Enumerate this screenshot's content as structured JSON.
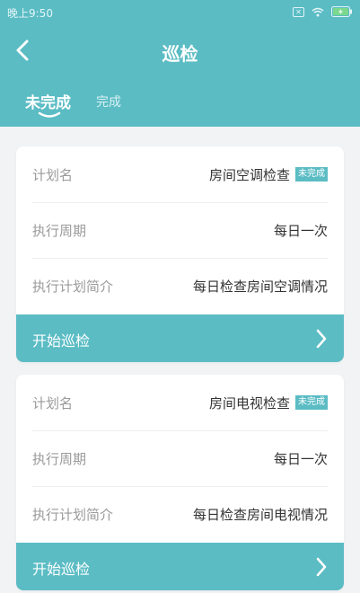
{
  "status_bar": {
    "time": "晚上9:50"
  },
  "header": {
    "title": "巡检",
    "back_icon": "chevron-left-icon"
  },
  "tabs": [
    {
      "label": "未完成",
      "active": true
    },
    {
      "label": "完成",
      "active": false
    }
  ],
  "colors": {
    "accent": "#5bbcc4",
    "background": "#f2f3f5"
  },
  "cards": [
    {
      "plan_name_label": "计划名",
      "plan_name": "房间空调检查",
      "status_badge": "未完成",
      "cycle_label": "执行周期",
      "cycle": "每日一次",
      "intro_label": "执行计划简介",
      "intro": "每日检查房间空调情况",
      "action_label": "开始巡检"
    },
    {
      "plan_name_label": "计划名",
      "plan_name": "房间电视检查",
      "status_badge": "未完成",
      "cycle_label": "执行周期",
      "cycle": "每日一次",
      "intro_label": "执行计划简介",
      "intro": "每日检查房间电视情况",
      "action_label": "开始巡检"
    }
  ]
}
